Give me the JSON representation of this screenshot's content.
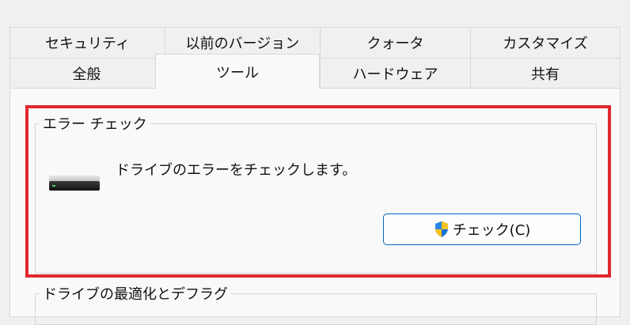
{
  "tabs_row1": [
    {
      "label": "セキュリティ"
    },
    {
      "label": "以前のバージョン"
    },
    {
      "label": "クォータ"
    },
    {
      "label": "カスタマイズ"
    }
  ],
  "tabs_row2": [
    {
      "label": "全般"
    },
    {
      "label": "ツール",
      "selected": true
    },
    {
      "label": "ハードウェア"
    },
    {
      "label": "共有"
    }
  ],
  "error_check": {
    "group_title": "エラー チェック",
    "description": "ドライブのエラーをチェックします。",
    "button_label": "チェック(C)",
    "button_icon": "uac-shield-icon",
    "drive_icon": "drive-icon"
  },
  "optimize": {
    "group_title": "ドライブの最適化とデフラグ"
  },
  "colors": {
    "highlight": "#e0282e",
    "button_border": "#0067c0"
  }
}
